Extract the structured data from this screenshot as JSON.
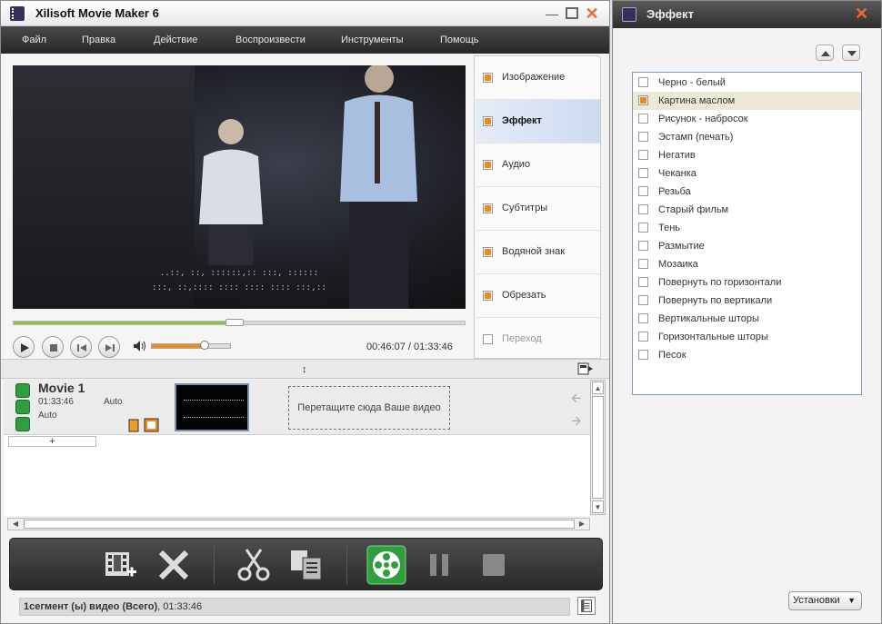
{
  "app": {
    "title": "Xilisoft Movie Maker 6"
  },
  "menu": [
    "Файл",
    "Правка",
    "Действие",
    "Воспроизвести",
    "Инструменты",
    "Помощь"
  ],
  "player": {
    "subtitle_lines": [
      "..::, ::, ::::::,:: :::, ::::::",
      ":::, ::,:::: :::: :::: :::: :::,::"
    ],
    "current_time": "00:46:07",
    "total_time": "01:33:46",
    "time_display": "00:46:07 / 01:33:46",
    "seek_progress": 0.49,
    "volume_level": 0.68
  },
  "tabs": [
    {
      "label": "Изображение",
      "checked": true,
      "active": false
    },
    {
      "label": "Эффект",
      "checked": true,
      "active": true
    },
    {
      "label": "Аудио",
      "checked": true,
      "active": false
    },
    {
      "label": "Субтитры",
      "checked": true,
      "active": false
    },
    {
      "label": "Водяной знак",
      "checked": true,
      "active": false
    },
    {
      "label": "Обрезать",
      "checked": true,
      "active": false
    },
    {
      "label": "Переход",
      "checked": false,
      "active": false
    }
  ],
  "timeline": {
    "movie_title": "Movie 1",
    "movie_duration": "01:33:46",
    "movie_audio": "Auto",
    "movie_subtitle": "Auto",
    "drop_zone_text": "Перетащите сюда Ваше видео",
    "add_track_label": "+"
  },
  "status": {
    "segments_label": "1сегмент (ы) видео (Всего)",
    "total_time": ", 01:33:46"
  },
  "effect_panel": {
    "title": "Эффект",
    "settings_label": "Установки",
    "effects": [
      {
        "label": "Черно - белый",
        "checked": false
      },
      {
        "label": "Картина маслом",
        "checked": true
      },
      {
        "label": "Рисунок - набросок",
        "checked": false
      },
      {
        "label": "Эстамп (печать)",
        "checked": false
      },
      {
        "label": "Негатив",
        "checked": false
      },
      {
        "label": "Чеканка",
        "checked": false
      },
      {
        "label": "Резьба",
        "checked": false
      },
      {
        "label": "Старый фильм",
        "checked": false
      },
      {
        "label": "Тень",
        "checked": false
      },
      {
        "label": "Размытие",
        "checked": false
      },
      {
        "label": "Мозаика",
        "checked": false
      },
      {
        "label": "Повернуть по горизонтали",
        "checked": false
      },
      {
        "label": "Повернуть по вертикали",
        "checked": false
      },
      {
        "label": "Вертикальные шторы",
        "checked": false
      },
      {
        "label": "Горизонтальные шторы",
        "checked": false
      },
      {
        "label": "Песок",
        "checked": false
      }
    ]
  },
  "colors": {
    "accent": "#f08a1a",
    "seek": "#8bc34a",
    "toolbar": "#2a2a2a",
    "close": "#f06a2a",
    "convert": "#2e9e3e"
  }
}
